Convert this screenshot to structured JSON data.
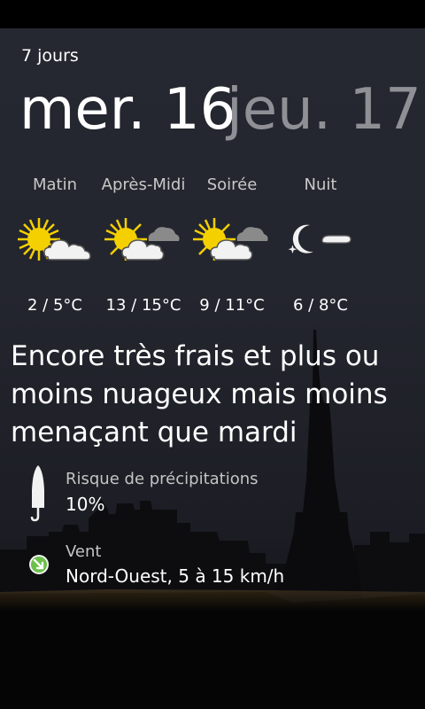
{
  "app": {
    "title": "7 jours"
  },
  "days": {
    "current": "mer. 16",
    "next": "jeu. 17"
  },
  "periods": [
    {
      "label": "Matin",
      "temp": "2 / 5°C",
      "icon": "sun-cloud-icon"
    },
    {
      "label": "Après-Midi",
      "temp": "13 / 15°C",
      "icon": "sun-clouds-icon"
    },
    {
      "label": "Soirée",
      "temp": "9 / 11°C",
      "icon": "sun-clouds-icon"
    },
    {
      "label": "Nuit",
      "temp": "6 / 8°C",
      "icon": "moon-cloud-icon"
    }
  ],
  "summary": "Encore très frais et plus ou moins nuageux mais moins menaçant que mardi",
  "precipitation": {
    "label": "Risque de précipitations",
    "value": "10%",
    "icon": "umbrella-icon"
  },
  "wind": {
    "label": "Vent",
    "value": "Nord-Ouest, 5 à 15 km/h",
    "icon": "wind-direction-icon"
  },
  "colors": {
    "sun": "#f5d000",
    "cloud_white": "#f2f2f2",
    "cloud_gray": "#8a8a8a",
    "next_day": "#8f9096",
    "wind_badge": "#6cc04a"
  }
}
